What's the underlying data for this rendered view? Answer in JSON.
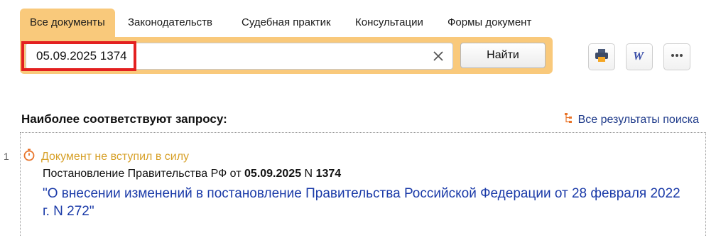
{
  "tabs": [
    {
      "label": "Все документы",
      "active": true
    },
    {
      "label": "Законодательств"
    },
    {
      "label": "Судебная практик"
    },
    {
      "label": "Консультации"
    },
    {
      "label": "Формы документ"
    }
  ],
  "search": {
    "value": "05.09.2025 1374",
    "clear_icon": "close-icon",
    "button_label": "Найти"
  },
  "toolbar": {
    "print_icon": "print-icon",
    "word_icon": "word-icon",
    "more_icon": "more-icon"
  },
  "results": {
    "heading": "Наиболее соответствуют запросу:",
    "all_results_label": "Все результаты поиска",
    "items": [
      {
        "number": "1",
        "status": "Документ не вступил в силу",
        "doc_prefix": "Постановление Правительства РФ от",
        "date": "05.09.2025",
        "n_label": "N",
        "doc_number": "1374",
        "title": "\"О внесении изменений в постановление Правительства Российской Федерации от 28 февраля 2022 г. N 272\""
      }
    ]
  },
  "colors": {
    "accent": "#f9c97b",
    "status": "#d7a12a",
    "link": "#1a3aa8",
    "highlight": "#e32020"
  }
}
